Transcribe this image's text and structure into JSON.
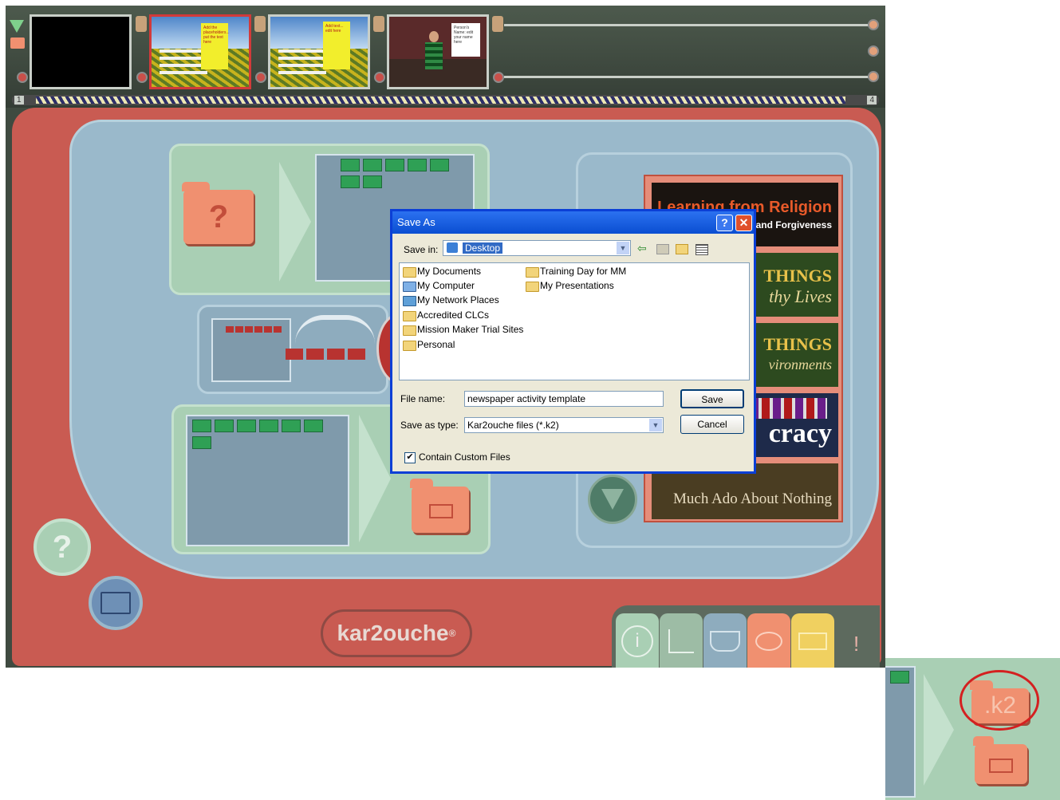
{
  "timeline": {
    "start_number": "1",
    "end_number": "4",
    "frames": [
      {
        "kind": "black"
      },
      {
        "kind": "field",
        "selected": true,
        "note": "Add the placeholders... put the text here"
      },
      {
        "kind": "field",
        "selected": false,
        "note": "Add text... edit here"
      },
      {
        "kind": "character",
        "selected": false,
        "note": "Person's Name: edit your name here"
      }
    ]
  },
  "cards": [
    {
      "title": "Learning from Religion",
      "subtitle": "and Forgiveness"
    },
    {
      "title": "THINGS",
      "subtitle": "thy Lives"
    },
    {
      "title": "THINGS",
      "subtitle": "vironments"
    },
    {
      "title": "cracy",
      "subtitle": ""
    },
    {
      "title": "Much Ado About Nothing",
      "subtitle": ""
    }
  ],
  "brand": {
    "logo": "kar2ouche",
    "registered": "®"
  },
  "help_symbol": "?",
  "bottom_tabs": {
    "info": "i",
    "alert": "!"
  },
  "dialog": {
    "title": "Save As",
    "help_button": "?",
    "close_button": "✕",
    "save_in_label": "Save in:",
    "save_in_value": "Desktop",
    "items": [
      {
        "name": "My Documents",
        "icon": "documents-folder-icon"
      },
      {
        "name": "My Computer",
        "icon": "computer-icon"
      },
      {
        "name": "My Network Places",
        "icon": "network-icon"
      },
      {
        "name": "Accredited CLCs",
        "icon": "folder-icon"
      },
      {
        "name": "Mission Maker Trial Sites",
        "icon": "folder-icon"
      },
      {
        "name": "Personal",
        "icon": "folder-icon"
      },
      {
        "name": "Training Day for MM",
        "icon": "folder-icon"
      },
      {
        "name": "My Presentations",
        "icon": "folder-icon"
      }
    ],
    "file_name_label": "File name:",
    "file_name_value": "newspaper activity template",
    "save_type_label": "Save as type:",
    "save_type_value": "Kar2ouche files (*.k2)",
    "save_button": "Save",
    "cancel_button": "Cancel",
    "checkbox_label": "Contain Custom Files",
    "checkbox_checked": true,
    "checkbox_mark": "✔"
  },
  "inset": {
    "k2_folder_label": ".k2",
    "highlight_color": "#d42020"
  },
  "colors": {
    "panel_red": "#c95b52",
    "panel_blue": "#9ab9cb",
    "panel_green": "#a9cfb4",
    "xp_blue": "#0a4ed1"
  }
}
